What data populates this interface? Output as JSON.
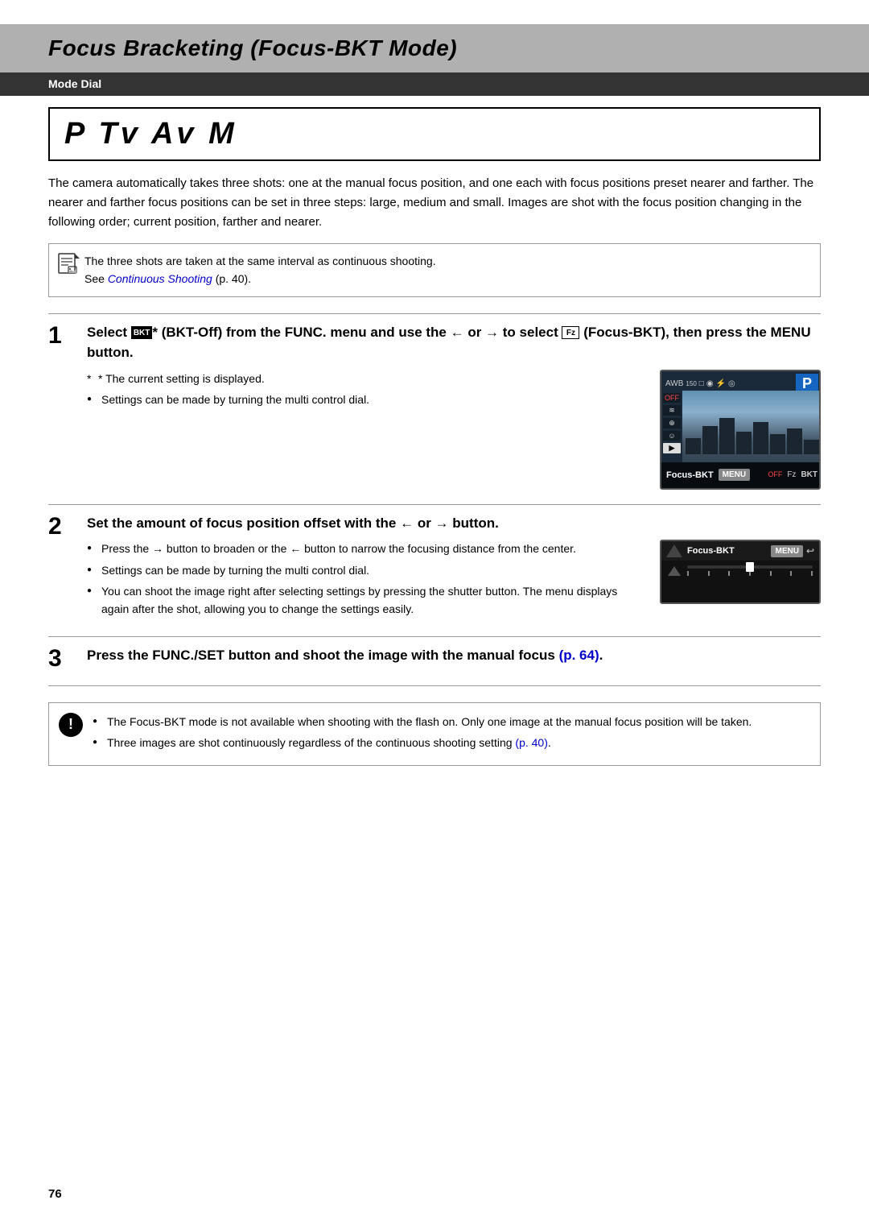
{
  "page": {
    "title": "Focus Bracketing (Focus-BKT Mode)",
    "mode_dial_label": "Mode Dial",
    "modes": "P Tv Av M",
    "page_number": "76"
  },
  "intro": {
    "text": "The camera automatically takes three shots: one at the manual focus position, and one each with focus positions preset nearer and farther. The nearer and farther focus positions can be set in three steps: large, medium and small. Images are shot with the focus position changing in the following order; current position, farther and nearer."
  },
  "note_box": {
    "line1": "The three shots are taken at the same interval as continuous shooting.",
    "line2_prefix": "See ",
    "line2_link_text": "Continuous Shooting",
    "line2_suffix": " (p. 40)."
  },
  "steps": [
    {
      "number": "1",
      "title_parts": {
        "before_bkt": "Select ",
        "bkt_icon": "BKT",
        "between": "* (BKT-Off) from the FUNC. menu and use the ← or → to select ",
        "focus_icon": "F",
        "after_focus": " (Focus-BKT), then press the MENU button."
      },
      "note_star": "* The current setting is displayed.",
      "bullet1": "Settings can be made by turning the multi control dial.",
      "cam_labels": {
        "focus_bkt": "Focus-BKT",
        "menu": "MENU"
      }
    },
    {
      "number": "2",
      "title": "Set the amount of focus position offset with the ← or → button.",
      "bullet1": "Press the → button to broaden or the ← button to narrow the focusing distance from the center.",
      "bullet2": "Settings can be made by turning the multi control dial.",
      "bullet3": "You can shoot the image right after selecting settings by pressing the shutter button. The menu displays again after the shot, allowing you to change the settings easily.",
      "cam_labels": {
        "focus_bkt": "Focus-BKT",
        "menu": "MENU"
      }
    },
    {
      "number": "3",
      "title_before_link": "Press the FUNC./SET button and shoot the image with the manual focus ",
      "link_text": "(p. 64)",
      "title_after_link": "."
    }
  ],
  "warning": {
    "bullet1": "The Focus-BKT mode is not available when shooting with the flash on. Only one image at the manual focus position will be taken.",
    "bullet2_prefix": "Three images are shot continuously regardless of the continuous shooting setting ",
    "bullet2_link": "(p. 40)",
    "bullet2_suffix": "."
  }
}
